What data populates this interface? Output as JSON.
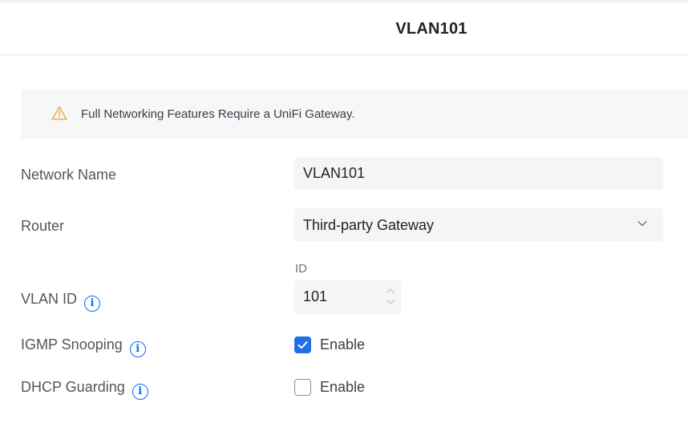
{
  "header": {
    "title": "VLAN101"
  },
  "banner": {
    "icon": "warning-icon",
    "message": "Full Networking Features Require a UniFi Gateway.",
    "icon_color": "#f0a63a"
  },
  "form": {
    "network_name": {
      "label": "Network Name",
      "value": "VLAN101"
    },
    "router": {
      "label": "Router",
      "value": "Third-party Gateway"
    },
    "vlan_id": {
      "label": "VLAN ID",
      "caption": "ID",
      "value": "101"
    },
    "igmp_snooping": {
      "label": "IGMP Snooping",
      "option": "Enable",
      "checked": true
    },
    "dhcp_guarding": {
      "label": "DHCP Guarding",
      "option": "Enable",
      "checked": false
    }
  },
  "colors": {
    "accent": "#006fff",
    "checkbox": "#1f6fe5"
  }
}
